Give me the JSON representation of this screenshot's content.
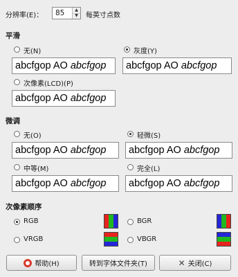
{
  "resolution": {
    "label": "分辨率(E)：",
    "value": "85",
    "unit": "每英寸点数"
  },
  "smoothing": {
    "title": "平滑",
    "options": [
      {
        "label": "无(N)",
        "selected": false
      },
      {
        "label": "灰度(Y)",
        "selected": true
      },
      {
        "label": "次像素(LCD)(P)",
        "selected": false
      }
    ]
  },
  "hinting": {
    "title": "微调",
    "options": [
      {
        "label": "无(O)",
        "selected": false
      },
      {
        "label": "轻微(S)",
        "selected": true
      },
      {
        "label": "中等(M)",
        "selected": false
      },
      {
        "label": "完全(L)",
        "selected": false
      }
    ]
  },
  "preview_text": {
    "normal": "abcfgop AO ",
    "italic": "abcfgop"
  },
  "subpixel": {
    "title": "次像素顺序",
    "options": [
      {
        "label": "RGB",
        "selected": true,
        "colors": [
          "#e8231d",
          "#1fb81f",
          "#2525d8"
        ]
      },
      {
        "label": "BGR",
        "selected": false,
        "colors": [
          "#2525d8",
          "#1fb81f",
          "#e8231d"
        ]
      },
      {
        "label": "VRGB",
        "selected": false,
        "colors": [
          "#e8231d",
          "#1fb81f",
          "#2525d8"
        ]
      },
      {
        "label": "VBGR",
        "selected": false,
        "colors": [
          "#2525d8",
          "#1fb81f",
          "#e8231d"
        ]
      }
    ]
  },
  "buttons": {
    "help": "帮助(H)",
    "goto_fonts": "转到字体文件夹(T)",
    "close": "关闭(C)"
  }
}
